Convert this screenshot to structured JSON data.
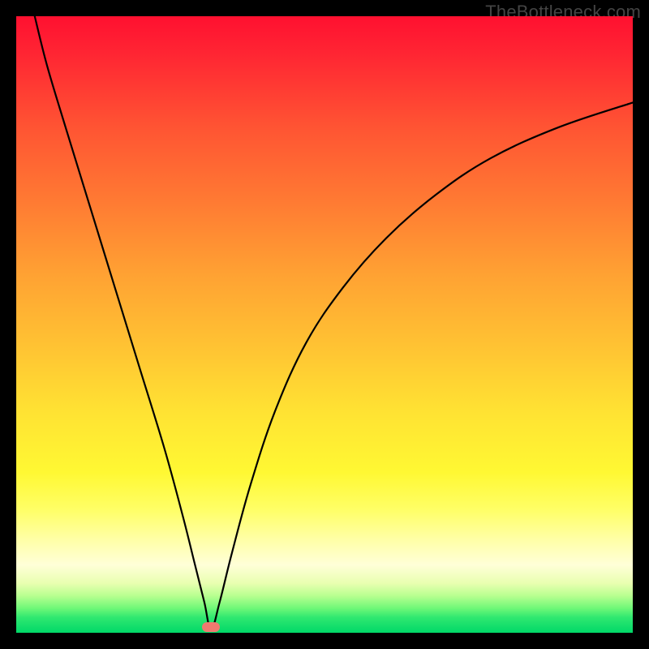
{
  "attribution": "TheBottleneck.com",
  "chart_data": {
    "type": "line",
    "title": "",
    "xlabel": "",
    "ylabel": "",
    "xlim": [
      0,
      100
    ],
    "ylim": [
      0,
      100
    ],
    "grid": false,
    "legend": false,
    "series": [
      {
        "name": "bottleneck-curve",
        "x": [
          3,
          5,
          8,
          12,
          16,
          20,
          24,
          27,
          29,
          30.5,
          31.6,
          33,
          35,
          38,
          42,
          47,
          53,
          60,
          68,
          77,
          88,
          100
        ],
        "y": [
          100,
          92,
          82,
          69,
          56,
          43,
          30,
          19,
          11,
          5,
          0.5,
          5,
          13,
          24,
          36,
          47,
          56,
          64,
          71,
          77,
          82,
          86
        ]
      }
    ],
    "marker": {
      "x": 31.6,
      "y": 0.9,
      "color": "#ef7a6f"
    },
    "background_gradient": [
      {
        "stop": 0,
        "color": "#ff1030"
      },
      {
        "stop": 50,
        "color": "#ffc433"
      },
      {
        "stop": 85,
        "color": "#ffffc0"
      },
      {
        "stop": 100,
        "color": "#00d868"
      }
    ]
  }
}
